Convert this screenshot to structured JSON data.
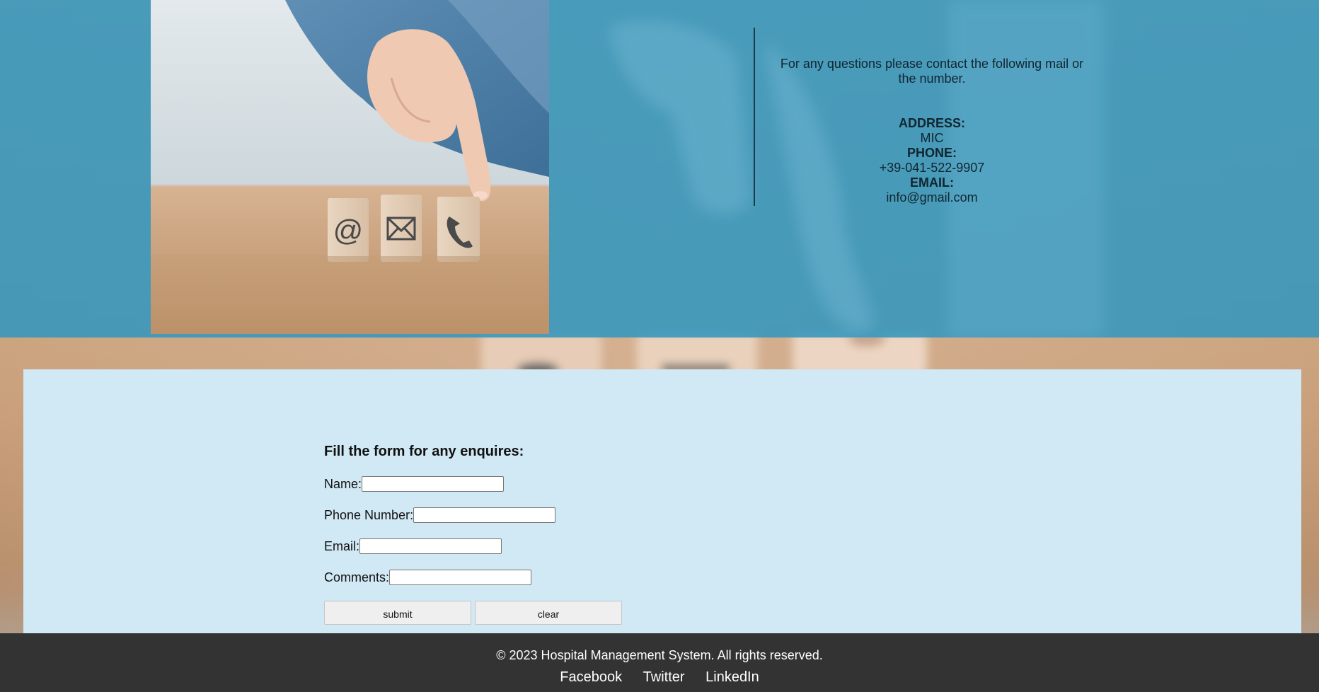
{
  "contact": {
    "intro": "For any questions please contact the following mail or the number.",
    "address_label": "ADDRESS:",
    "address_value": "MIC",
    "phone_label": "PHONE:",
    "phone_value": "+39-041-522-9907",
    "email_label": "EMAIL:",
    "email_value": "info@gmail.com",
    "photo_icons": [
      "at-sign-icon",
      "envelope-icon",
      "phone-icon"
    ]
  },
  "form": {
    "title": "Fill the form for any enquires:",
    "name_label": "Name:",
    "phone_label": "Phone Number:",
    "email_label": "Email:",
    "comments_label": "Comments:",
    "submit_label": "submit",
    "clear_label": "clear"
  },
  "footer": {
    "copyright": "© 2023 Hospital Management System. All rights reserved.",
    "links": [
      "Facebook",
      "Twitter",
      "LinkedIn"
    ]
  },
  "colors": {
    "band": "#3496be",
    "form_panel": "#d1e8f5",
    "footer": "#333333"
  }
}
